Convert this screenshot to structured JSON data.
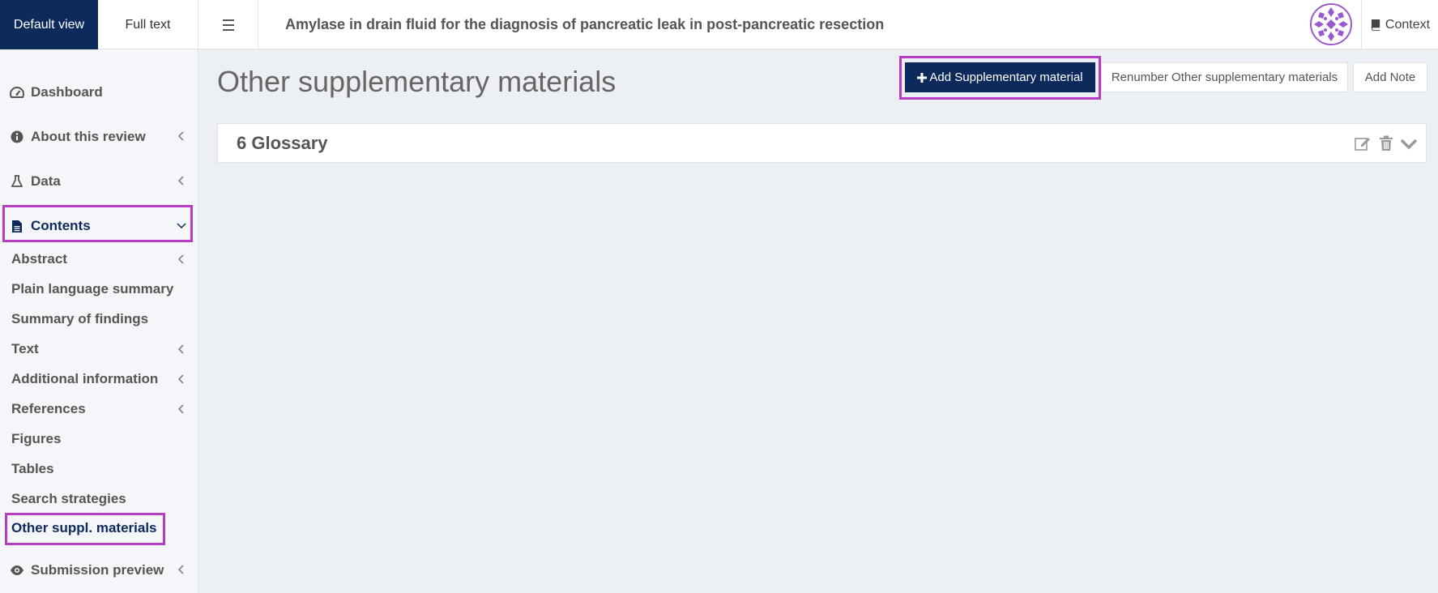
{
  "topbar": {
    "default_view": "Default view",
    "full_text": "Full text",
    "menu_icon": "hamburger-icon",
    "title": "Amylase in drain fluid for the diagnosis of pancreatic leak in post-pancreatic resection",
    "context_label": "Context",
    "context_icon": "book-icon",
    "logo": "cochrane-logo"
  },
  "sidebar": {
    "items": [
      {
        "label": "Dashboard",
        "icon": "dashboard-icon"
      },
      {
        "label": "About this review",
        "icon": "info-icon"
      },
      {
        "label": "Data",
        "icon": "flask-icon"
      },
      {
        "label": "Contents",
        "icon": "document-icon"
      },
      {
        "label": "Submission preview",
        "icon": "eye-icon"
      }
    ],
    "contents_sub": [
      {
        "label": "Abstract"
      },
      {
        "label": "Plain language summary"
      },
      {
        "label": "Summary of findings"
      },
      {
        "label": "Text"
      },
      {
        "label": "Additional information"
      },
      {
        "label": "References"
      },
      {
        "label": "Figures"
      },
      {
        "label": "Tables"
      },
      {
        "label": "Search strategies"
      },
      {
        "label": "Other suppl. materials"
      }
    ]
  },
  "main": {
    "page_title": "Other supplementary materials",
    "add_button": "Add Supplementary material",
    "renumber_button": "Renumber Other supplementary materials",
    "note_button": "Add Note",
    "panels": [
      {
        "title": "6 Glossary"
      }
    ]
  },
  "colors": {
    "brand": "#0d2a5c",
    "highlight": "#b53dc0",
    "background": "#ecf0f5"
  }
}
